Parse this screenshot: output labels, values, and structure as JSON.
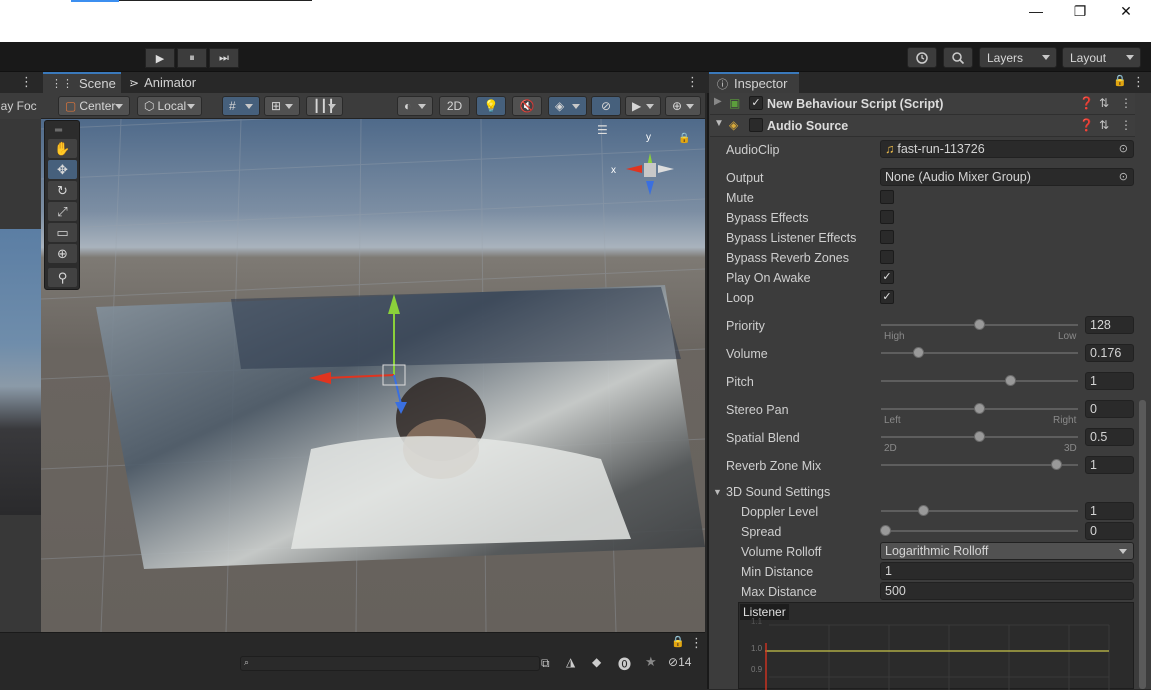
{
  "window": {
    "minimize_glyph": "—",
    "restore_glyph": "❐",
    "close_glyph": "✕"
  },
  "toolbar": {
    "play_glyph": "▶",
    "pause_glyph": "⏸",
    "step_glyph": "⏭",
    "history_icon": "history-icon",
    "search_icon": "search-icon",
    "layers_label": "Layers",
    "layout_label": "Layout"
  },
  "left_panel": {
    "partial_label": "lay Foc"
  },
  "scene_tabs": {
    "scene_label": "Scene",
    "animator_label": "Animator"
  },
  "scene_toolbar": {
    "pivot_label": "Center",
    "space_label": "Local",
    "mode_2d_label": "2D"
  },
  "gizmo": {
    "y_label": "y",
    "x_label": "x"
  },
  "bottom_panel": {
    "hidden_count": "14"
  },
  "inspector": {
    "tab_label": "Inspector",
    "components": [
      {
        "name": "New Behaviour Script (Script)",
        "enabled": true
      },
      {
        "name": "Audio Source",
        "enabled": false
      }
    ],
    "audio_source": {
      "audio_clip_label": "AudioClip",
      "audio_clip_value": "fast-run-113726",
      "output_label": "Output",
      "output_value": "None (Audio Mixer Group)",
      "mute_label": "Mute",
      "bypass_effects_label": "Bypass Effects",
      "bypass_listener_label": "Bypass Listener Effects",
      "bypass_reverb_label": "Bypass Reverb Zones",
      "play_on_awake_label": "Play On Awake",
      "loop_label": "Loop",
      "checks": {
        "mute": false,
        "bypass_effects": false,
        "bypass_listener": false,
        "bypass_reverb": false,
        "play_on_awake": true,
        "loop": true
      },
      "check_glyph": "✓",
      "priority_label": "Priority",
      "priority_value": "128",
      "priority_min_label": "High",
      "priority_max_label": "Low",
      "volume_label": "Volume",
      "volume_value": "0.176",
      "pitch_label": "Pitch",
      "pitch_value": "1",
      "stereo_pan_label": "Stereo Pan",
      "stereo_pan_value": "0",
      "stereo_min_label": "Left",
      "stereo_max_label": "Right",
      "spatial_blend_label": "Spatial Blend",
      "spatial_blend_value": "0.5",
      "spatial_min_label": "2D",
      "spatial_max_label": "3D",
      "reverb_mix_label": "Reverb Zone Mix",
      "reverb_mix_value": "1",
      "sound3d_label": "3D Sound Settings",
      "doppler_label": "Doppler Level",
      "doppler_value": "1",
      "spread_label": "Spread",
      "spread_value": "0",
      "rolloff_label": "Volume Rolloff",
      "rolloff_value": "Logarithmic Rolloff",
      "min_distance_label": "Min Distance",
      "min_distance_value": "1",
      "max_distance_label": "Max Distance",
      "max_distance_value": "500",
      "graph_label": "Listener",
      "graph_tick_1": "1.0",
      "graph_tick_2": "0.9",
      "graph_tick_top": "1.1"
    }
  },
  "colors": {
    "accent": "#3a79bb",
    "x_axis": "#e0341f",
    "y_axis": "#8bd13b",
    "z_axis": "#3a6fe0"
  }
}
